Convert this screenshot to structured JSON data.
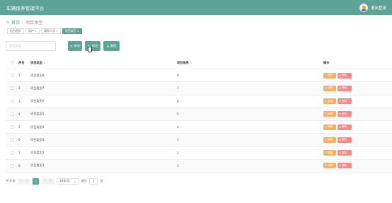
{
  "header": {
    "title": "车辆保养管理平台",
    "logout_label": "退出登录"
  },
  "breadcrumb": {
    "home": "首页",
    "current": "项目类型"
  },
  "tags": [
    {
      "label": "后台首页"
    },
    {
      "label": "用户"
    },
    {
      "label": "保养人员"
    },
    {
      "label": "项目类型"
    }
  ],
  "search": {
    "placeholder": "项目类型",
    "search_label": "查询",
    "add_label": "添加",
    "delete_label": "删除"
  },
  "table": {
    "headers": {
      "index": "序号",
      "name": "项目类型",
      "sort": "项目排序",
      "ops": "操作"
    },
    "edit_label": "修改",
    "delete_label": "删除",
    "rows": [
      {
        "index": "1",
        "name": "项目类型8",
        "sort": "8"
      },
      {
        "index": "2",
        "name": "项目类型7",
        "sort": "7"
      },
      {
        "index": "3",
        "name": "项目类型6",
        "sort": "6"
      },
      {
        "index": "4",
        "name": "项目类型5",
        "sort": "5"
      },
      {
        "index": "5",
        "name": "项目类型4",
        "sort": "4"
      },
      {
        "index": "6",
        "name": "项目类型3",
        "sort": "3"
      },
      {
        "index": "7",
        "name": "项目类型2",
        "sort": "2"
      },
      {
        "index": "8",
        "name": "项目类型1",
        "sort": "1"
      }
    ]
  },
  "pagination": {
    "total_text": "共 8 条",
    "prev_label": "上一页",
    "current_page": "1",
    "next_label": "下一页",
    "page_size": "10条/页",
    "goto_label": "前往",
    "goto_value": "1",
    "page_unit": "页"
  },
  "colors": {
    "primary": "#5fa397",
    "edit": "#f4b06a",
    "delete": "#f48b8b"
  }
}
